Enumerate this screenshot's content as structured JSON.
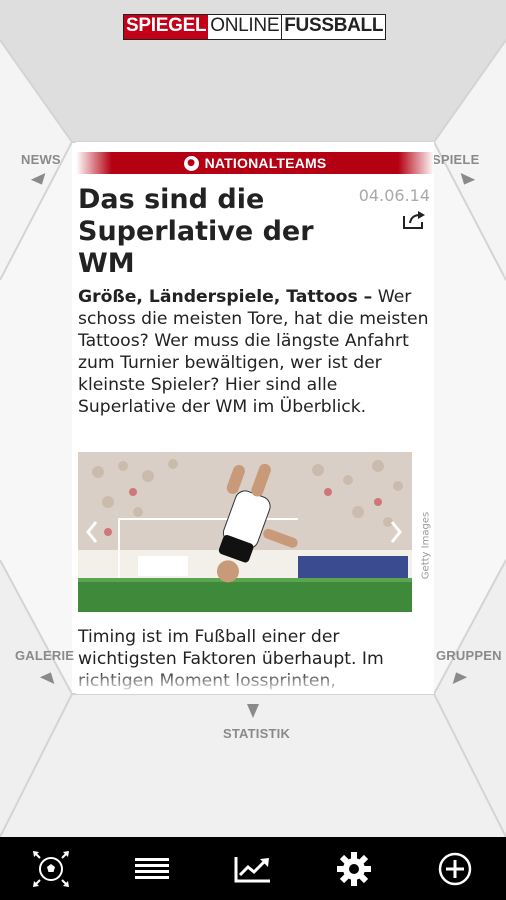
{
  "header": {
    "logo_part1": "SPIEGEL",
    "logo_part2": "ONLINE",
    "logo_part3": "FUSSBALL"
  },
  "nav": {
    "news": "NEWS",
    "spiele": "SPIELE",
    "galerie": "GALERIE",
    "gruppen": "GRUPPEN",
    "statistik": "STATISTIK"
  },
  "article": {
    "category": "NATIONALTEAMS",
    "date": "04.06.14",
    "title": "Das sind die Superlative der WM",
    "teaser_lead": "Größe, Länderspiele, Tattoos –",
    "teaser_text": " Wer schoss die meisten Tore, hat die meisten Tattoos? Wer muss die längste Anfahrt zum Turnier bewältigen, wer ist der kleinste Spieler? Hier sind alle Superlative der WM im Überblick.",
    "image_credit": "Getty Images",
    "body": "Timing ist im Fußball einer der wichtigsten Faktoren überhaupt. Im richtigen Moment lossprinten,"
  },
  "icons": {
    "share": "share-icon",
    "ball": "soccer-ball-icon",
    "list": "list-icon",
    "chart": "trend-chart-icon",
    "settings": "gear-icon",
    "add": "plus-circle-icon"
  },
  "colors": {
    "accent_red": "#b40012",
    "background": "#e9e9e9",
    "bar": "#000000"
  }
}
